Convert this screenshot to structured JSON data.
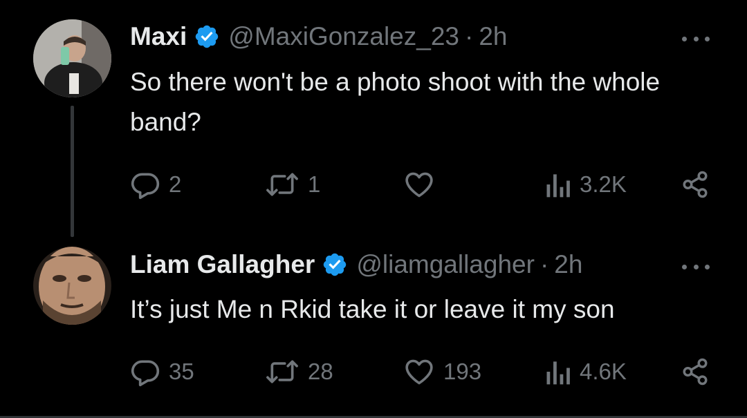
{
  "tweets": [
    {
      "author_name": "Maxi",
      "handle": "@MaxiGonzalez_23",
      "separator": "·",
      "time": "2h",
      "text": "So there won't be a photo shoot with the whole band?",
      "replies": "2",
      "retweets": "1",
      "likes": "",
      "views": "3.2K",
      "verified": true
    },
    {
      "author_name": "Liam Gallagher",
      "handle": "@liamgallagher",
      "separator": "·",
      "time": "2h",
      "text": "It’s just Me n Rkid take it or leave it my son",
      "replies": "35",
      "retweets": "28",
      "likes": "193",
      "views": "4.6K",
      "verified": true
    }
  ],
  "colors": {
    "background": "#000000",
    "primary_text": "#e7e9ea",
    "secondary_text": "#71767b",
    "verified_badge": "#1d9bf0",
    "thread_line": "#333639"
  },
  "icons": [
    "reply-icon",
    "retweet-icon",
    "like-icon",
    "views-icon",
    "share-icon",
    "verified-badge-icon",
    "more-options-icon"
  ]
}
